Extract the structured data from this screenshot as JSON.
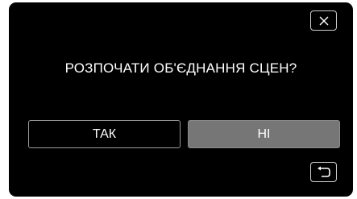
{
  "dialog": {
    "prompt": "РОЗПОЧАТИ ОБ'ЄДНАННЯ СЦЕН?",
    "yes_label": "ТАК",
    "no_label": "НІ"
  },
  "icons": {
    "close": "close-icon",
    "back": "back-arrow-icon"
  },
  "colors": {
    "panel_background": "#000000",
    "text": "#ffffff",
    "selected_button": "#767676",
    "button_border": "#9a9a9a"
  }
}
